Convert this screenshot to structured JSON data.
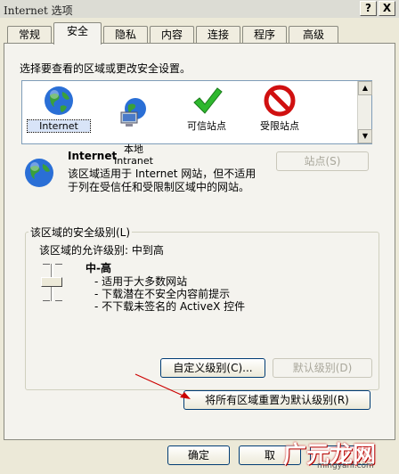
{
  "window": {
    "title": "Internet 选项",
    "help_button": "?",
    "close_button": "X"
  },
  "tabs": [
    {
      "label": "常规",
      "active": false
    },
    {
      "label": "安全",
      "active": true
    },
    {
      "label": "隐私",
      "active": false
    },
    {
      "label": "内容",
      "active": false
    },
    {
      "label": "连接",
      "active": false
    },
    {
      "label": "程序",
      "active": false
    },
    {
      "label": "高级",
      "active": false
    }
  ],
  "security": {
    "prompt": "选择要查看的区域或更改安全设置。",
    "zones": [
      {
        "label": "Internet",
        "icon": "globe-icon",
        "selected": true
      },
      {
        "label": "本地\nIntranet",
        "icon": "intranet-icon",
        "selected": false
      },
      {
        "label": "可信站点",
        "icon": "checkmark-icon",
        "selected": false
      },
      {
        "label": "受限站点",
        "icon": "no-entry-icon",
        "selected": false
      }
    ],
    "zone_info": {
      "title": "Internet",
      "description": "该区域适用于 Internet 网站，但不适用于列在受信任和受限制区域中的网站。"
    },
    "sites_button": "站点(S)",
    "level_group": {
      "title": "该区域的安全级别(L)",
      "allowed_levels": "该区域的允许级别: 中到高",
      "level_name": "中-高",
      "bullets": [
        "适用于大多数网站",
        "下载潜在不安全内容前提示",
        "不下载未签名的 ActiveX 控件"
      ],
      "custom_button": "自定义级别(C)...",
      "default_button": "默认级别(D)"
    },
    "reset_button": "将所有区域重置为默认级别(R)"
  },
  "footer": {
    "ok": "确定",
    "cancel": "取",
    "apply": ""
  },
  "watermark": {
    "logo": "广元龙网",
    "url": "mingyanl.com"
  },
  "colors": {
    "accent": "#003c74",
    "panel": "#f4f3ee",
    "annotation_arrow": "#cc0000"
  }
}
